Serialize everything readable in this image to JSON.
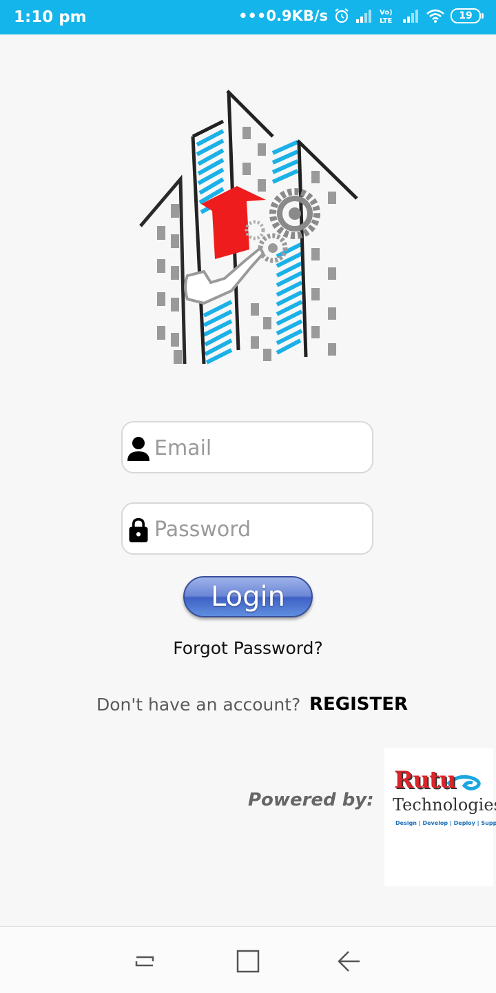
{
  "status_bar": {
    "time": "1:10 pm",
    "network_speed": "•••0.9KB/s",
    "battery": "19",
    "icons": [
      "alarm-icon",
      "signal-icon",
      "volte-icon",
      "signal-icon",
      "wifi-icon",
      "battery-icon"
    ]
  },
  "login_form": {
    "email_placeholder": "Email",
    "password_placeholder": "Password",
    "login_label": "Login",
    "forgot_label": "Forgot Password?",
    "no_account_text": "Don't have an account?",
    "register_label": "REGISTER"
  },
  "footer": {
    "powered_by": "Powered by:",
    "company_name": "Rutu",
    "company_sub": "Technologies",
    "company_tagline": "Design | Develop | Deploy | Support"
  },
  "colors": {
    "status_bar": "#14b5ea",
    "accent_blue": "#1bb1e7",
    "logo_red": "#ee1c1c",
    "login_button": "#5f7fd3"
  },
  "navigation": {
    "buttons": [
      "recents-icon",
      "home-icon",
      "back-icon"
    ]
  }
}
